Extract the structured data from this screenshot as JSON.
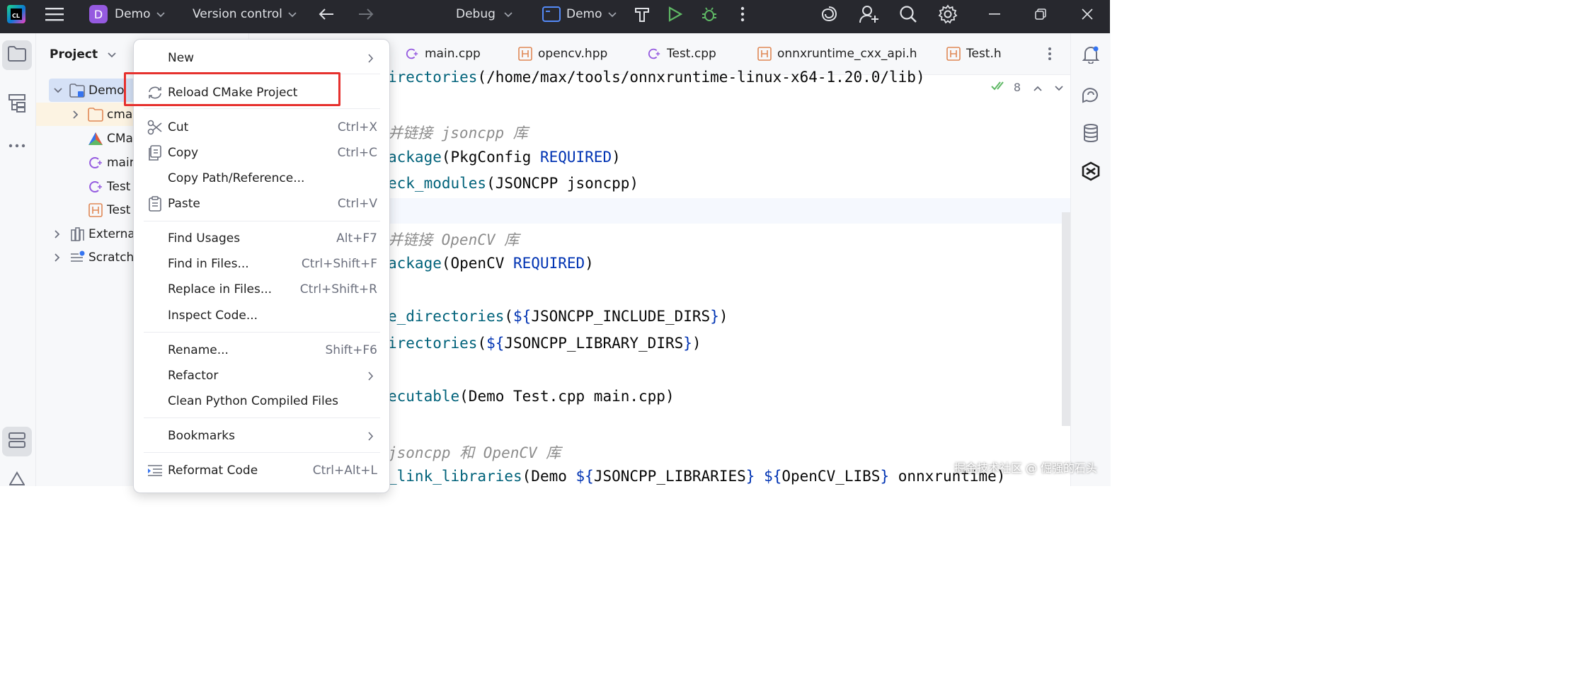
{
  "titlebar": {
    "logo_text": "CL",
    "project_initial": "D",
    "project_name": "Demo",
    "vcs_label": "Version control",
    "build_config": "Debug",
    "run_target": "Demo"
  },
  "project_panel": {
    "title": "Project",
    "tree": [
      {
        "label": "Demo",
        "icon": "project-folder-icon"
      },
      {
        "label": "cmal",
        "icon": "folder-icon"
      },
      {
        "label": "CMa",
        "icon": "cmake-icon"
      },
      {
        "label": "mair",
        "icon": "cpp-file-icon"
      },
      {
        "label": "Test",
        "icon": "cpp-file-icon"
      },
      {
        "label": "Test",
        "icon": "header-file-icon"
      },
      {
        "label": "External",
        "icon": "library-icon"
      },
      {
        "label": "Scratche",
        "icon": "scratch-icon"
      }
    ]
  },
  "tabs": [
    {
      "label": "main.cpp",
      "icon": "cpp-file-icon"
    },
    {
      "label": "opencv.hpp",
      "icon": "header-file-icon"
    },
    {
      "label": "Test.cpp",
      "icon": "cpp-file-icon"
    },
    {
      "label": "onnxruntime_cxx_api.h",
      "icon": "header-file-icon"
    },
    {
      "label": "Test.h",
      "icon": "header-file-icon"
    }
  ],
  "editor": {
    "inspection_count": "8",
    "lines": [
      {
        "parts": [
          [
            "fn",
            "irectories"
          ],
          [
            "plain",
            "(/home/max/tools/onnxruntime-linux-x64-1.20.0/lib)"
          ]
        ]
      },
      {
        "parts": [
          [
            "cmt",
            "并链接 jsoncpp 库"
          ]
        ]
      },
      {
        "parts": [
          [
            "fn",
            "ackage"
          ],
          [
            "plain",
            "(PkgConfig "
          ],
          [
            "const",
            "REQUIRED"
          ],
          [
            "plain",
            ")"
          ]
        ]
      },
      {
        "parts": [
          [
            "fn",
            "eck_modules"
          ],
          [
            "plain",
            "(JSONCPP jsoncpp)"
          ]
        ]
      },
      {
        "parts": [
          [
            "cmt",
            "并链接 OpenCV 库"
          ]
        ]
      },
      {
        "parts": [
          [
            "fn",
            "ackage"
          ],
          [
            "plain",
            "(OpenCV "
          ],
          [
            "const",
            "REQUIRED"
          ],
          [
            "plain",
            ")"
          ]
        ]
      },
      {
        "parts": [
          [
            "fn",
            "e_directories"
          ],
          [
            "plain",
            "("
          ],
          [
            "const",
            "${"
          ],
          [
            "plain",
            "JSONCPP_INCLUDE_DIRS"
          ],
          [
            "const",
            "}"
          ],
          [
            "plain",
            ")"
          ]
        ]
      },
      {
        "parts": [
          [
            "fn",
            "irectories"
          ],
          [
            "plain",
            "("
          ],
          [
            "const",
            "${"
          ],
          [
            "plain",
            "JSONCPP_LIBRARY_DIRS"
          ],
          [
            "const",
            "}"
          ],
          [
            "plain",
            ")"
          ]
        ]
      },
      {
        "parts": [
          [
            "fn",
            "ecutable"
          ],
          [
            "plain",
            "(Demo Test.cpp main.cpp)"
          ]
        ]
      },
      {
        "parts": [
          [
            "cmt",
            "jsoncpp 和 OpenCV 库"
          ]
        ]
      },
      {
        "parts": [
          [
            "fn",
            "_link_libraries"
          ],
          [
            "plain",
            "(Demo "
          ],
          [
            "const",
            "${"
          ],
          [
            "plain",
            "JSONCPP_LIBRARIES"
          ],
          [
            "const",
            "}"
          ],
          [
            "plain",
            " "
          ],
          [
            "const",
            "${"
          ],
          [
            "plain",
            "OpenCV_LIBS"
          ],
          [
            "const",
            "}"
          ],
          [
            "plain",
            " onnxruntime)"
          ]
        ]
      }
    ]
  },
  "context_menu": {
    "items": [
      {
        "label": "New",
        "submenu": true
      },
      {
        "label": "Reload CMake Project",
        "icon": "reload-icon"
      },
      {
        "label": "Cut",
        "shortcut": "Ctrl+X",
        "icon": "scissors-icon"
      },
      {
        "label": "Copy",
        "shortcut": "Ctrl+C",
        "icon": "copy-icon"
      },
      {
        "label": "Copy Path/Reference..."
      },
      {
        "label": "Paste",
        "shortcut": "Ctrl+V",
        "icon": "paste-icon"
      },
      {
        "label": "Find Usages",
        "shortcut": "Alt+F7"
      },
      {
        "label": "Find in Files...",
        "shortcut": "Ctrl+Shift+F"
      },
      {
        "label": "Replace in Files...",
        "shortcut": "Ctrl+Shift+R"
      },
      {
        "label": "Inspect Code..."
      },
      {
        "label": "Rename...",
        "shortcut": "Shift+F6"
      },
      {
        "label": "Refactor",
        "submenu": true
      },
      {
        "label": "Clean Python Compiled Files"
      },
      {
        "label": "Bookmarks",
        "submenu": true
      },
      {
        "label": "Reformat Code",
        "shortcut": "Ctrl+Alt+L",
        "icon": "reformat-icon"
      }
    ]
  },
  "watermark": "掘金技术社区 @ 倔强的石头",
  "colors": {
    "titlebar": "#27282e",
    "highlight_box": "#e6312e",
    "accent": "#3574f0"
  }
}
